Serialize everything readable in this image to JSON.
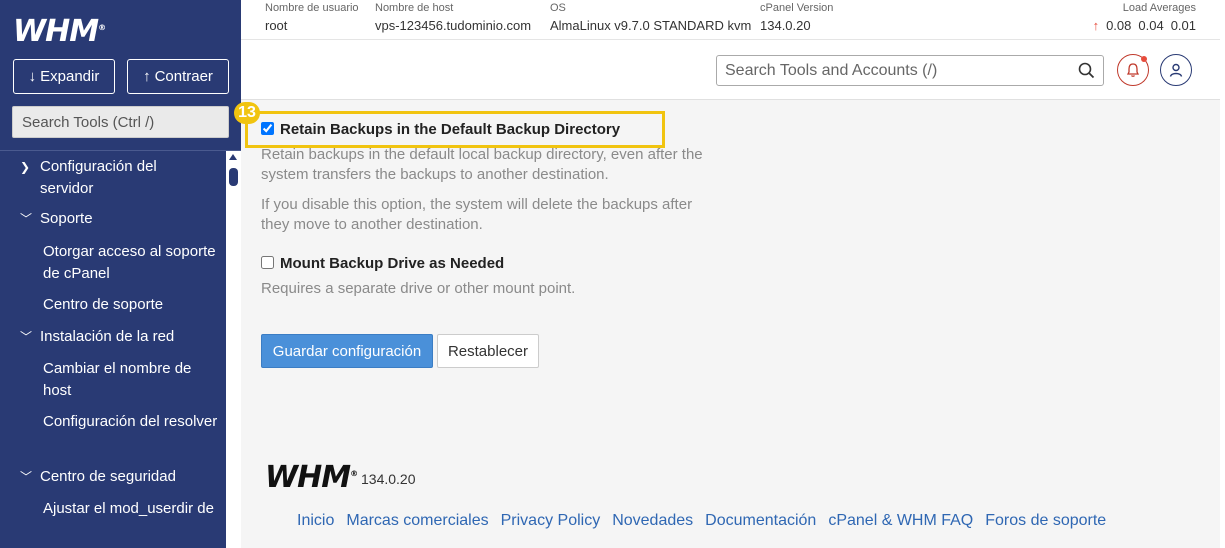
{
  "app": {
    "logo": "WHM",
    "logo_mark": "®"
  },
  "sidebar": {
    "expand_label": "Expandir",
    "collapse_label": "Contraer",
    "search_placeholder": "Search Tools (Ctrl /)",
    "items": [
      {
        "label": "Configuración del servidor",
        "type": "category",
        "expanded": false
      },
      {
        "label": "Soporte",
        "type": "category",
        "expanded": true
      },
      {
        "label": "Otorgar acceso al soporte de cPanel",
        "type": "link"
      },
      {
        "label": "Centro de soporte",
        "type": "link"
      },
      {
        "label": "Instalación de la red",
        "type": "category",
        "expanded": true
      },
      {
        "label": "Cambiar el nombre de host",
        "type": "link"
      },
      {
        "label": "Configuración del resolver",
        "type": "link"
      },
      {
        "label": "Centro de seguridad",
        "type": "category",
        "expanded": true
      },
      {
        "label": "Ajustar el mod_userdir de",
        "type": "link"
      }
    ]
  },
  "header": {
    "username_label": "Nombre de usuario",
    "username": "root",
    "hostname_label": "Nombre de host",
    "hostname": "vps-123456.tudominio.com",
    "os_label": "OS",
    "os": "AlmaLinux v9.7.0 STANDARD kvm",
    "version_label": "cPanel Version",
    "version": "134.0.20",
    "load_label": "Load Averages",
    "loads": [
      "0.08",
      "0.04",
      "0.01"
    ],
    "search_placeholder": "Search Tools and Accounts (/)"
  },
  "main": {
    "step_number": "13",
    "retain": {
      "label": "Retain Backups in the Default Backup Directory",
      "checked": true,
      "help1": "Retain backups in the default local backup directory, even after the system transfers the backups to another destination.",
      "help2": "If you disable this option, the system will delete the backups after they move to another destination."
    },
    "mount": {
      "label": "Mount Backup Drive as Needed",
      "checked": false,
      "help": "Requires a separate drive or other mount point."
    },
    "save_label": "Guardar configuración",
    "reset_label": "Restablecer"
  },
  "footer": {
    "logo": "WHM",
    "version": "134.0.20",
    "links": [
      "Inicio",
      "Marcas comerciales",
      "Privacy Policy",
      "Novedades",
      "Documentación",
      "cPanel & WHM FAQ",
      "Foros de soporte"
    ]
  },
  "colors": {
    "sidebar": "#293a74",
    "highlight": "#f1c40f",
    "primary_button": "#4a90d9",
    "link": "#2f67b3"
  }
}
